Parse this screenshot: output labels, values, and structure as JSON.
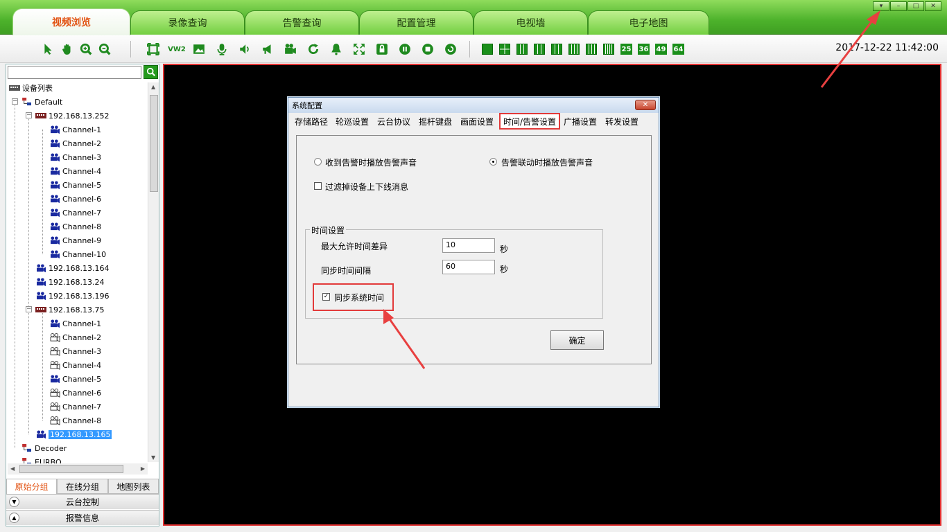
{
  "tabs": [
    "视频浏览",
    "录像查询",
    "告警查询",
    "配置管理",
    "电视墙",
    "电子地图"
  ],
  "active_tab": "视频浏览",
  "clock": "2017-12-22 11:42:00",
  "toolbar": {
    "grid_labels": [
      "25",
      "36",
      "49",
      "64"
    ]
  },
  "window_buttons": [
    "▾",
    "–",
    "□",
    "✕"
  ],
  "tree": {
    "root": "设备列表",
    "default": "Default",
    "dev1": "192.168.13.252",
    "dev1_channels": [
      "Channel-1",
      "Channel-2",
      "Channel-3",
      "Channel-4",
      "Channel-5",
      "Channel-6",
      "Channel-7",
      "Channel-8",
      "Channel-9",
      "Channel-10"
    ],
    "dev2": "192.168.13.164",
    "dev3": "192.168.13.24",
    "dev4": "192.168.13.196",
    "dev5": "192.168.13.75",
    "dev5_channels": [
      "Channel-1",
      "Channel-2",
      "Channel-3",
      "Channel-4",
      "Channel-5",
      "Channel-6",
      "Channel-7",
      "Channel-8"
    ],
    "dev6": "192.168.13.165",
    "decoder": "Decoder",
    "europ": "EURBO"
  },
  "bottom_tabs": [
    "原始分组",
    "在线分组",
    "地图列表"
  ],
  "accordion": {
    "ptz": "云台控制",
    "alarm": "报警信息"
  },
  "dialog": {
    "title": "系统配置",
    "close": "✕",
    "tabs": [
      "存储路径",
      "轮巡设置",
      "云台协议",
      "摇杆键盘",
      "画面设置",
      "时间/告警设置",
      "广播设置",
      "转发设置"
    ],
    "active_tab": "时间/告警设置",
    "radio_1": "收到告警时播放告警声音",
    "radio_2": "告警联动时播放告警声音",
    "filter_check": "过滤掉设备上下线消息",
    "group_title": "时间设置",
    "max_diff_label": "最大允许时间差异",
    "max_diff_value": "10",
    "interval_label": "同步时间间隔",
    "interval_value": "60",
    "unit": "秒",
    "sync_check": "同步系统时间",
    "ok": "确定"
  }
}
